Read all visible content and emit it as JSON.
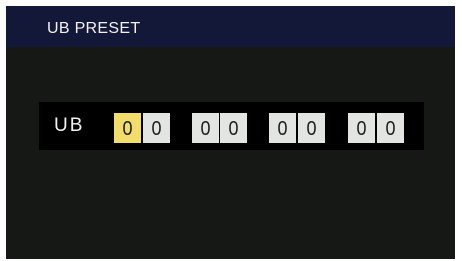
{
  "title": "UB PRESET",
  "ub_label": "UB",
  "digits": [
    "0",
    "0",
    "0",
    "0",
    "0",
    "0",
    "0",
    "0"
  ],
  "selected_digit_index": 0,
  "colors": {
    "title_bar": "#131738",
    "background": "#161815",
    "panel": "#000000",
    "digit_box": "#e3e5e2",
    "digit_selected": "#f2dc6a"
  }
}
